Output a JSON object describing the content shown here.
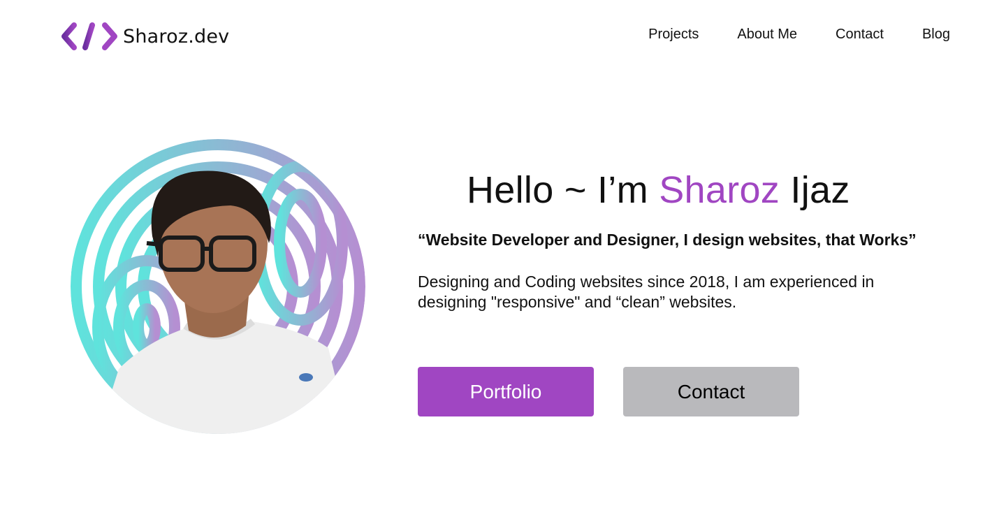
{
  "brand": {
    "logo_icon": "code-brackets-icon",
    "name": "Sharoz.dev",
    "accent_color": "#a046c2",
    "accent_dark": "#6b2fa0"
  },
  "nav": {
    "items": [
      "Projects",
      "About Me",
      "Contact",
      "Blog"
    ]
  },
  "hero": {
    "greeting": "Hello ~ I’m ",
    "first_name": "Sharoz",
    "last_name": " Ijaz",
    "tagline": "“Website Developer and Designer, I design websites, that Works”",
    "bio": "Designing and Coding websites since 2018, I am experienced in designing \"responsive\" and “clean” websites."
  },
  "portrait": {
    "icon": "profile-photo",
    "gradient_start": "#5fe3dc",
    "gradient_end": "#b58fd2"
  },
  "buttons": {
    "portfolio_label": "Portfolio",
    "contact_label": "Contact",
    "portfolio_color": "#a046c2",
    "contact_color": "#b9b9bc"
  }
}
